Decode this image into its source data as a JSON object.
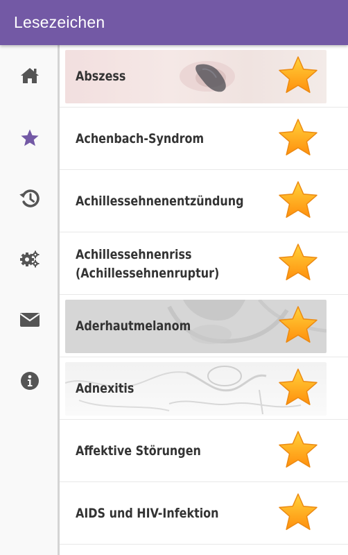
{
  "appbar": {
    "title": "Lesezeichen",
    "color": "#7359a5"
  },
  "sidebar": {
    "active_color": "#7359a5",
    "icon_color": "#555555",
    "items": [
      {
        "icon": "home-icon",
        "active": false
      },
      {
        "icon": "star-icon",
        "active": true
      },
      {
        "icon": "history-icon",
        "active": false
      },
      {
        "icon": "gears-icon",
        "active": false
      },
      {
        "icon": "mail-icon",
        "active": false
      },
      {
        "icon": "info-icon",
        "active": false
      }
    ]
  },
  "bookmarks": [
    {
      "label": "Abszess",
      "starred": true
    },
    {
      "label": "Achenbach-Syndrom",
      "starred": true
    },
    {
      "label": "Achillessehnenentzündung",
      "starred": true
    },
    {
      "label": "Achillessehnenriss\n(Achillessehnenruptur)",
      "starred": true
    },
    {
      "label": "Aderhautmelanom",
      "starred": true
    },
    {
      "label": "Adnexitis",
      "starred": true
    },
    {
      "label": "Affektive Störungen",
      "starred": true
    },
    {
      "label": "AIDS und HIV-Infektion",
      "starred": true
    }
  ]
}
